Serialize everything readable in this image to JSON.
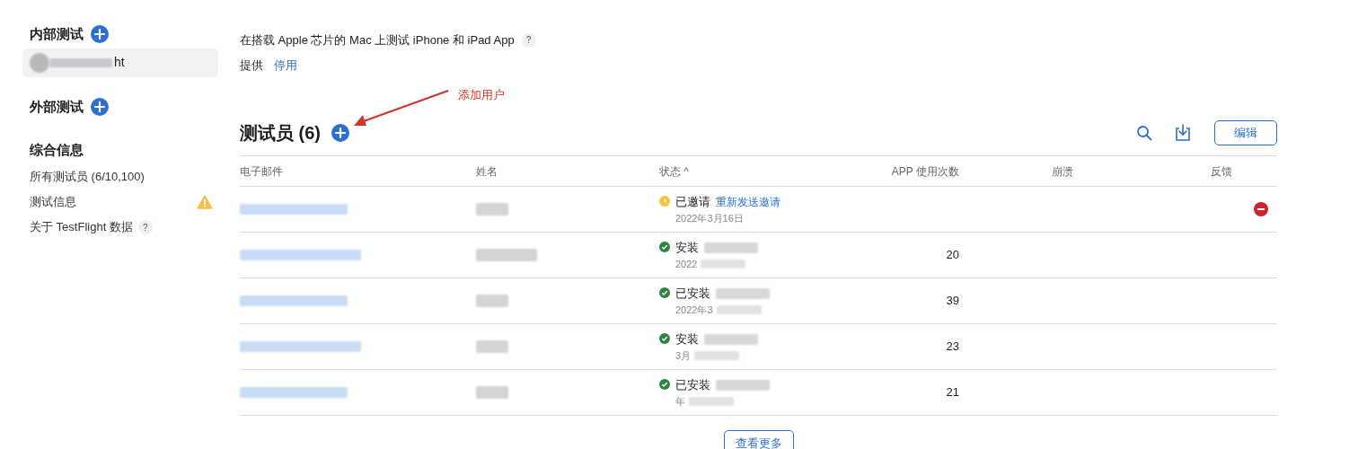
{
  "sidebar": {
    "sections": [
      {
        "title": "内部测试",
        "add_button": true,
        "items": [
          {
            "kind": "group",
            "text": "ht",
            "selected": true
          }
        ]
      },
      {
        "title": "外部测试",
        "add_button": true
      },
      {
        "title": "综合信息",
        "add_button": false,
        "items": [
          {
            "kind": "link",
            "text": "所有测试员 (6/10,100)",
            "selected": false
          },
          {
            "kind": "warning",
            "text": "测试信息",
            "selected": false
          },
          {
            "kind": "help",
            "text": "关于 TestFlight 数据",
            "help": "?",
            "selected": false
          }
        ]
      }
    ]
  },
  "settings": {
    "description": "在搭载 Apple 芯片的 Mac 上测试 iPhone 和 iPad App",
    "help": "?",
    "label": "提供",
    "action": "停用"
  },
  "annotation": {
    "text": "添加用户"
  },
  "testers": {
    "title": "测试员 (6)",
    "edit_button": "编辑",
    "columns": [
      "电子邮件",
      "姓名",
      "状态 ^",
      "APP 使用次数",
      "崩溃",
      "反馈"
    ],
    "rows": [
      {
        "kind": "invited",
        "status_text": "已邀请",
        "action": "重新发送邀请",
        "date": "2022年3月16日",
        "removable": true
      },
      {
        "kind": "installed",
        "status_text": "安装",
        "date": "2022",
        "uses": "20",
        "removable": false
      },
      {
        "kind": "installed",
        "status_text": "已安装",
        "date": "2022年3",
        "uses": "39",
        "removable": false
      },
      {
        "kind": "installed",
        "status_text": "安装",
        "date": "3月",
        "uses": "23",
        "removable": false
      },
      {
        "kind": "installed",
        "status_text": "已安装",
        "date": "年",
        "uses": "21",
        "removable": false
      }
    ],
    "more_button": "查看更多"
  }
}
